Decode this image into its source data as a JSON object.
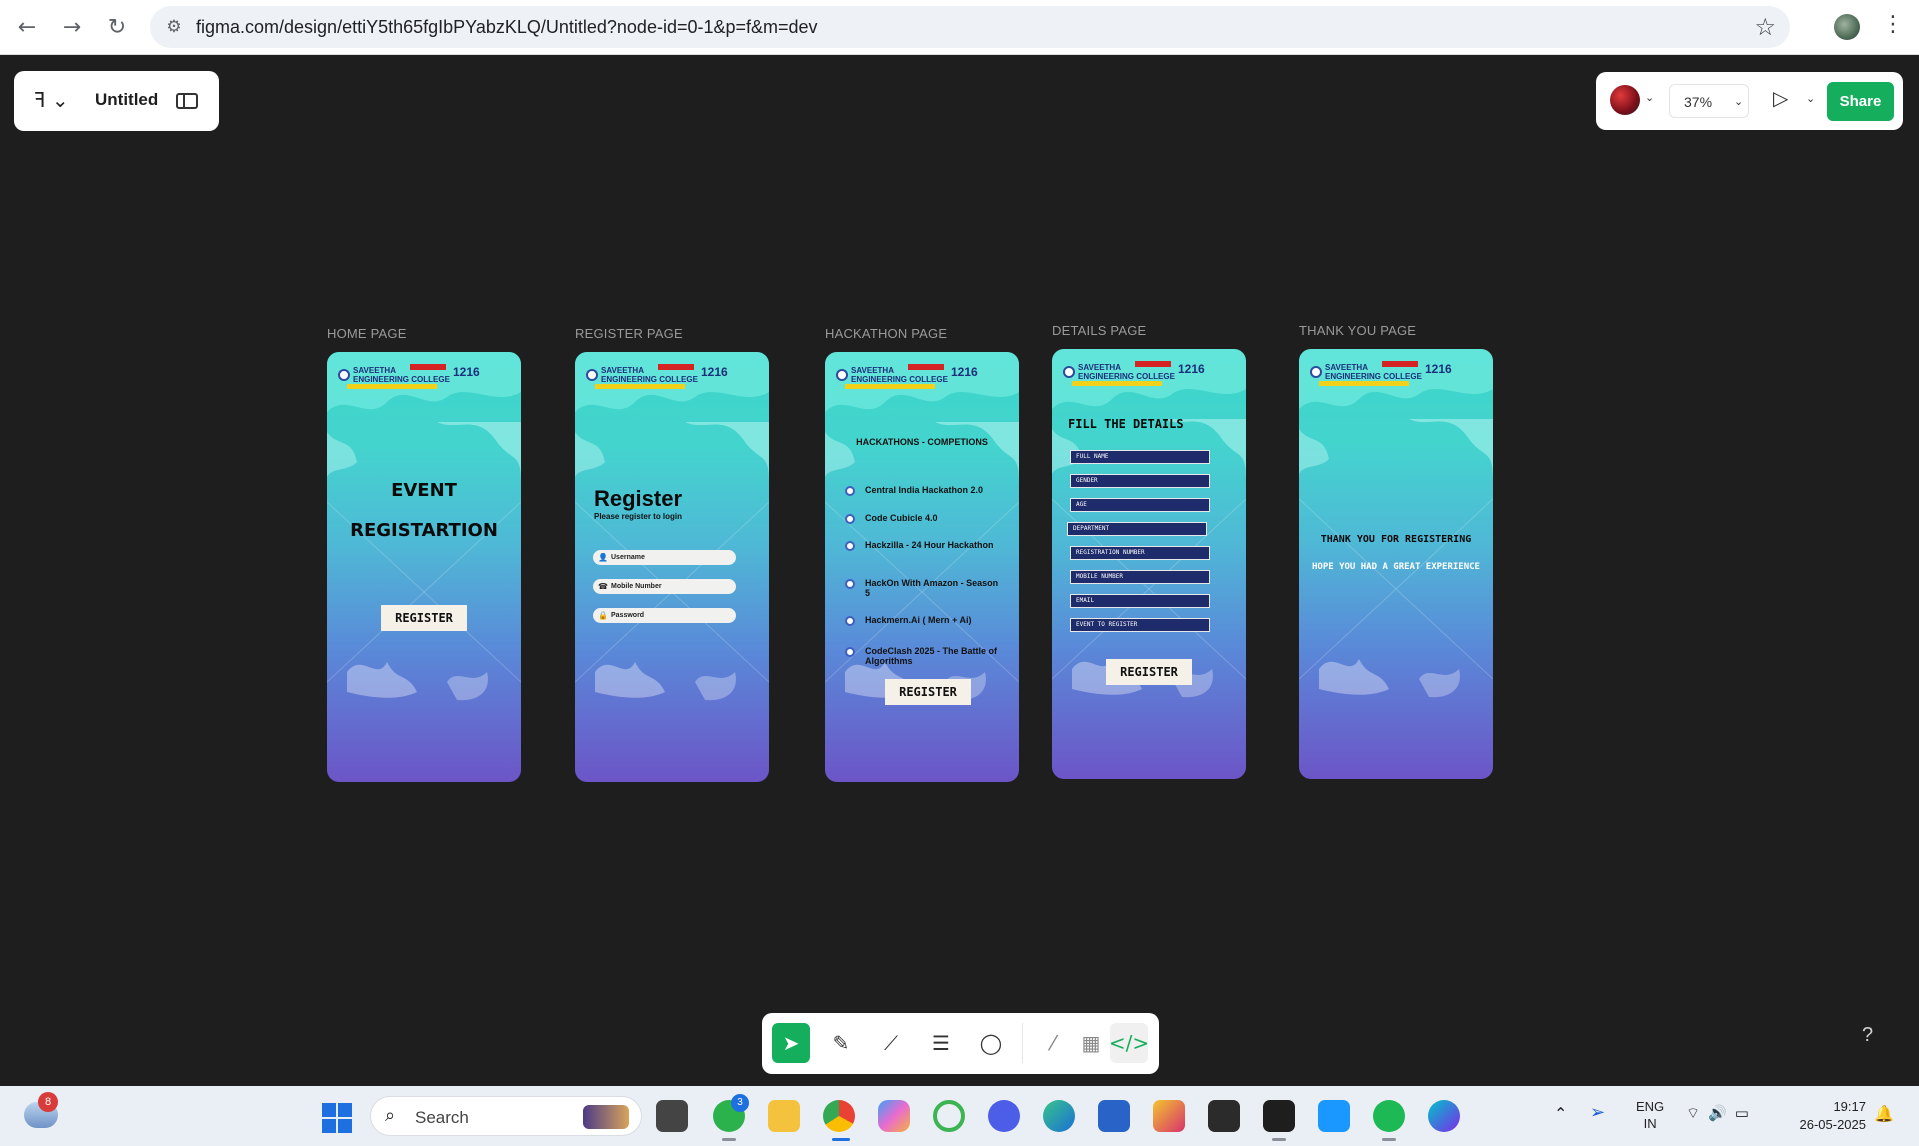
{
  "browser": {
    "url": "figma.com/design/ettiY5th65fgIbPYabzKLQ/Untitled?node-id=0-1&p=f&m=dev"
  },
  "figma": {
    "file_name": "Untitled",
    "zoom": "37%",
    "share_label": "Share"
  },
  "frames": {
    "home": {
      "label": "HOME PAGE",
      "title_line1": "EVENT",
      "title_line2": "REGISTARTION",
      "button": "REGISTER"
    },
    "register": {
      "label": "REGISTER PAGE",
      "title": "Register",
      "subtitle": "Please register to login",
      "fields": [
        "Username",
        "Mobile Number",
        "Password"
      ]
    },
    "hackathon": {
      "label": "HACKATHON PAGE",
      "title": "HACKATHONS - COMPETIONS",
      "items": [
        "Central India Hackathon 2.0",
        "Code Cubicle 4.0",
        "Hackzilla - 24 Hour Hackathon",
        "HackOn With Amazon - Season 5",
        "Hackmern.Ai ( Mern + Ai)",
        "CodeClash 2025 - The Battle of Algorithms"
      ],
      "button": "REGISTER"
    },
    "details": {
      "label": "DETAILS PAGE",
      "title": "FILL THE DETAILS",
      "fields": [
        "FULL NAME",
        "GENDER",
        "AGE",
        "DEPARTMENT",
        "REGISTRATION NUMBER",
        "MOBILE NUMBER",
        "EMAIL",
        "EVENT TO REGISTER"
      ],
      "button": "REGISTER"
    },
    "thankyou": {
      "label": "THANK YOU PAGE",
      "line1": "THANK YOU FOR REGISTERING",
      "line2": "HOPE YOU HAD A GREAT EXPERIENCE"
    }
  },
  "college": {
    "name_line1": "SAVEETHA",
    "name_line2": "ENGINEERING COLLEGE",
    "code": "1216"
  },
  "help": "?",
  "taskbar": {
    "weather_badge": "8",
    "search_placeholder": "Search",
    "whatsapp_badge": "3",
    "lang_line1": "ENG",
    "lang_line2": "IN",
    "time": "19:17",
    "date": "26-05-2025"
  }
}
